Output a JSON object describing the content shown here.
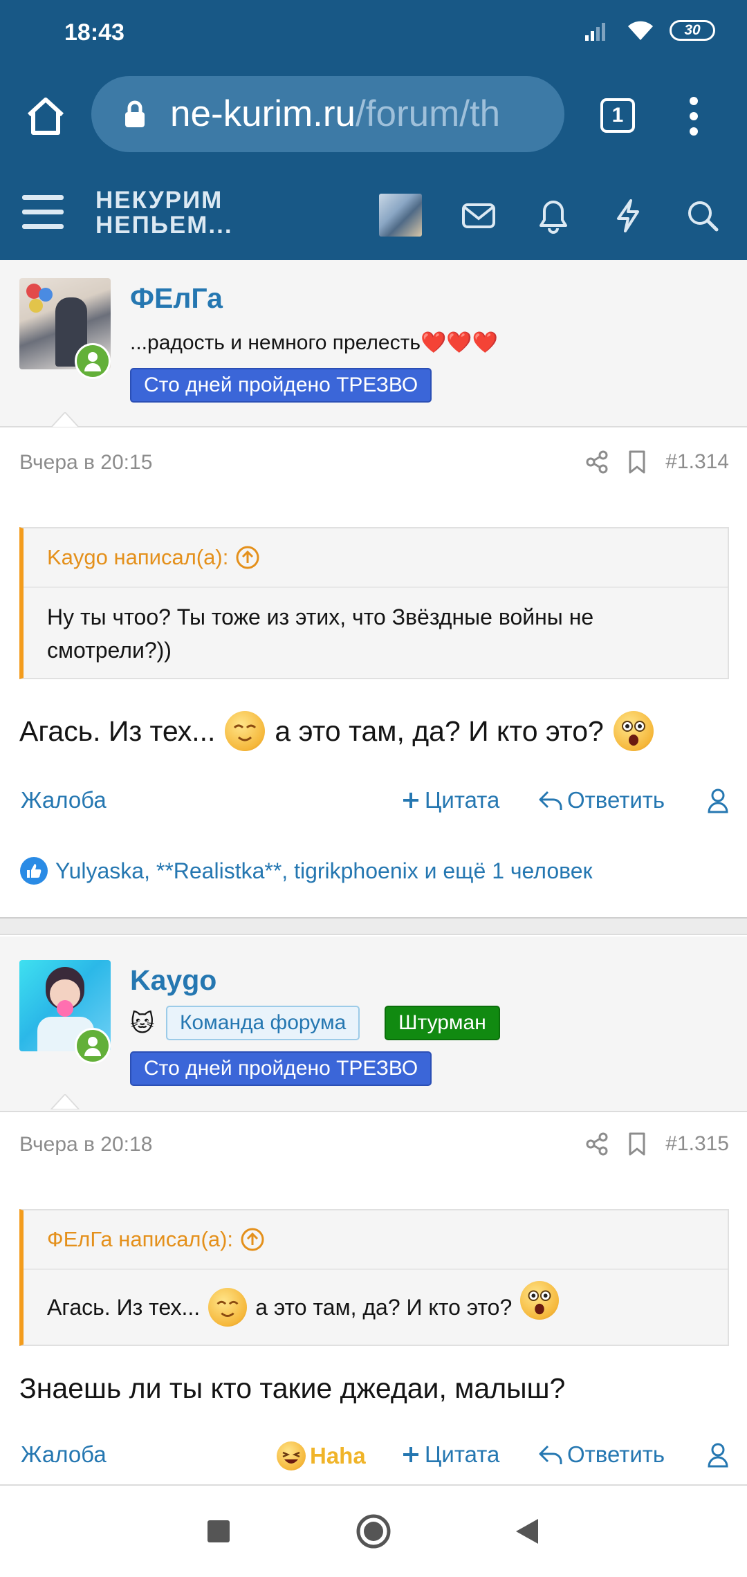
{
  "status": {
    "time": "18:43",
    "battery": "30"
  },
  "browser": {
    "url_domain": "ne-kurim.ru",
    "url_path": "/forum/th",
    "tab_count": "1"
  },
  "site": {
    "logo_line1": "НЕКУРИМ",
    "logo_line2": "НЕПЬЕМ..."
  },
  "post1": {
    "username": "ФЕлГа",
    "user_title": "...радость и немного прелесть",
    "hearts": "❤️❤️❤️",
    "banner": "Сто дней пройдено ТРЕЗВО",
    "date": "Вчера в 20:15",
    "number": "#1.314",
    "quote_author": "Kaygo написал(а):",
    "quote_text": "Ну ты чтоо? Ты тоже из этих, что Звёздные войны не смотрели?))",
    "body_part1": "Агась. Из тех...",
    "body_part2": "а это там, да? И кто это?",
    "report": "Жалоба",
    "quote_btn": "Цитата",
    "reply_btn": "Ответить",
    "likes": "Yulyaska, **Realistka**, tigrikphoenix и ещё 1 человек"
  },
  "post2": {
    "username": "Kaygo",
    "badge_team": "Команда форума",
    "badge_role": "Штурман",
    "banner": "Сто дней пройдено ТРЕЗВО",
    "date": "Вчера в 20:18",
    "number": "#1.315",
    "quote_author": "ФЕлГа написал(а):",
    "quote_part1": "Агась. Из тех...",
    "quote_part2": "а это там, да? И кто это?",
    "body": "Знаешь ли ты кто такие джедаи, малыш?",
    "report": "Жалоба",
    "reaction": "Haha",
    "quote_btn": "Цитата",
    "reply_btn": "Ответить"
  },
  "colors": {
    "brand": "#185886",
    "link": "#2577b1",
    "quote_accent": "#f39c1c",
    "online": "#63b039"
  }
}
